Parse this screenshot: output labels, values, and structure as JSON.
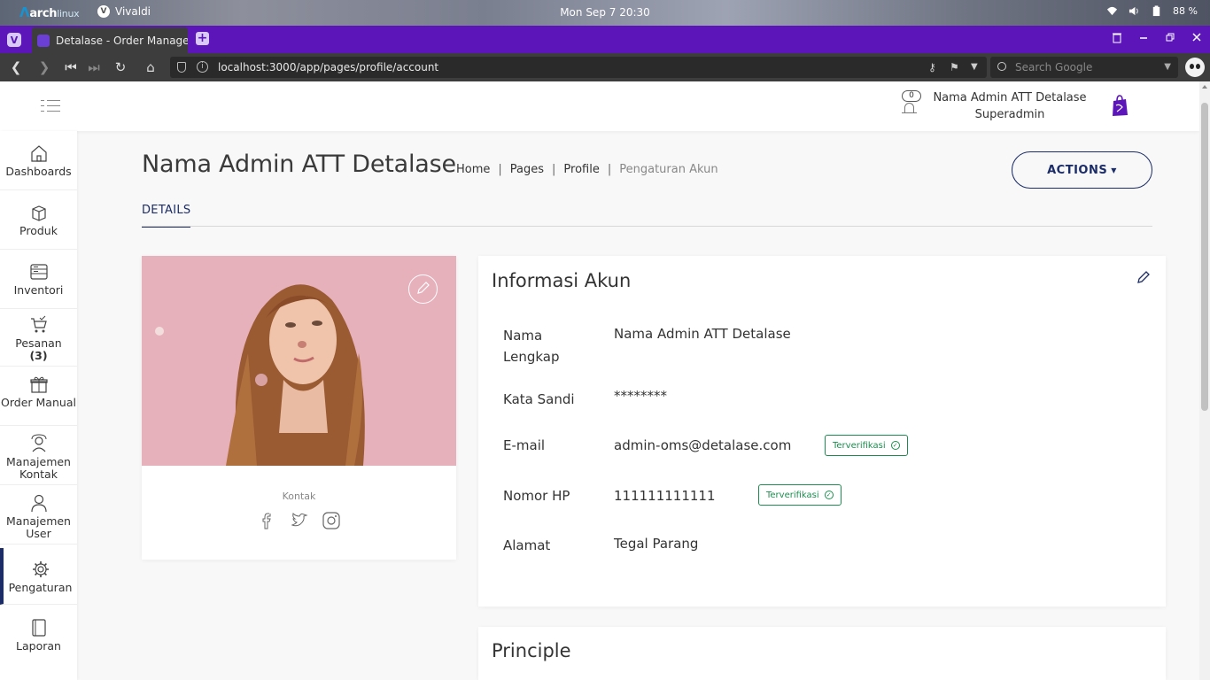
{
  "os": {
    "logo_main": "arch",
    "logo_sub": "linux",
    "app_name": "Vivaldi",
    "clock": "Mon Sep 7  20:30",
    "battery": "88 %"
  },
  "browser": {
    "tab_title": "Detalase - Order Managem",
    "url": "localhost:3000/app/pages/profile/account",
    "search_placeholder": "Search Google"
  },
  "header": {
    "notification_count": "0",
    "user_name": "Nama Admin ATT Detalase",
    "user_role": "Superadmin"
  },
  "sidebar": {
    "items": [
      {
        "label": "Dashboards",
        "icon": "home-icon"
      },
      {
        "label": "Produk",
        "icon": "box-icon"
      },
      {
        "label": "Inventori",
        "icon": "inventory-icon"
      },
      {
        "label": "Pesanan",
        "count": "(3)",
        "icon": "cart-icon"
      },
      {
        "label": "Order Manual",
        "icon": "gift-icon"
      },
      {
        "label": "Manajemen Kontak",
        "icon": "contact-icon"
      },
      {
        "label": "Manajemen User",
        "icon": "user-icon"
      },
      {
        "label": "Pengaturan",
        "icon": "gear-icon"
      },
      {
        "label": "Laporan",
        "icon": "notebook-icon"
      }
    ]
  },
  "page": {
    "title": "Nama Admin ATT Detalase",
    "breadcrumb": [
      "Home",
      "Pages",
      "Profile",
      "Pengaturan Akun"
    ],
    "actions_label": "ACTIONS",
    "tab_details": "DETAILS"
  },
  "profile_card": {
    "contact_label": "Kontak"
  },
  "account_info": {
    "title": "Informasi Akun",
    "rows": [
      {
        "label": "Nama Lengkap",
        "value": "Nama Admin ATT Detalase"
      },
      {
        "label": "Kata Sandi",
        "value": "********"
      },
      {
        "label": "E-mail",
        "value": "admin-oms@detalase.com",
        "badge": "Terverifikasi"
      },
      {
        "label": "Nomor HP",
        "value": "111111111111",
        "badge": "Terverifikasi"
      },
      {
        "label": "Alamat",
        "value": "Tegal Parang"
      }
    ]
  },
  "principle": {
    "title": "Principle"
  },
  "colors": {
    "primary": "#1b2c67",
    "browser_purple": "#5b15b8",
    "verified_green": "#1c8d4e"
  }
}
